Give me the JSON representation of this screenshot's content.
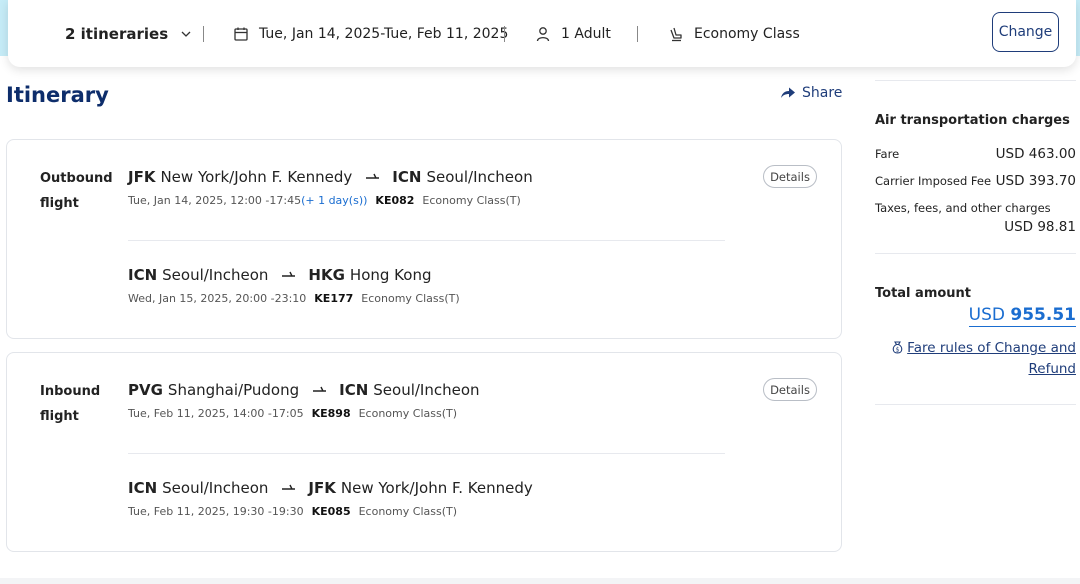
{
  "search": {
    "itineraries": "2 itineraries",
    "dates": "Tue, Jan 14, 2025-Tue, Feb 11, 2025",
    "passengers": "1 Adult",
    "cabin": "Economy Class",
    "change_label": "Change"
  },
  "page": {
    "title": "Itinerary",
    "share_label": "Share"
  },
  "outbound": {
    "label_line1": "Outbound",
    "label_line2": "flight",
    "details_label": "Details",
    "segments": [
      {
        "from_code": "JFK",
        "from_name": "New York/John F. Kennedy",
        "to_code": "ICN",
        "to_name": "Seoul/Incheon",
        "time": "Tue, Jan 14, 2025, 12:00 -17:45",
        "plus_day": "(+ 1 day(s))",
        "flight": "KE082",
        "cabin": "Economy Class(T)"
      },
      {
        "from_code": "ICN",
        "from_name": "Seoul/Incheon",
        "to_code": "HKG",
        "to_name": "Hong Kong",
        "time": "Wed, Jan 15, 2025, 20:00 -23:10",
        "flight": "KE177",
        "cabin": "Economy Class(T)"
      }
    ]
  },
  "inbound": {
    "label_line1": "Inbound",
    "label_line2": "flight",
    "details_label": "Details",
    "segments": [
      {
        "from_code": "PVG",
        "from_name": "Shanghai/Pudong",
        "to_code": "ICN",
        "to_name": "Seoul/Incheon",
        "time": "Tue, Feb 11, 2025, 14:00 -17:05",
        "flight": "KE898",
        "cabin": "Economy Class(T)"
      },
      {
        "from_code": "ICN",
        "from_name": "Seoul/Incheon",
        "to_code": "JFK",
        "to_name": "New York/John F. Kennedy",
        "time": "Tue, Feb 11, 2025, 19:30 -19:30",
        "flight": "KE085",
        "cabin": "Economy Class(T)"
      }
    ]
  },
  "summary": {
    "heading": "Air transportation charges",
    "fare_label": "Fare",
    "fare_value": "USD 463.00",
    "carrier_label": "Carrier Imposed Fee",
    "carrier_value": "USD 393.70",
    "taxes_label": "Taxes, fees, and other charges",
    "taxes_value": "USD 98.81",
    "total_label": "Total amount",
    "total_currency": "USD",
    "total_amount": "955.51",
    "rules_line1": "Fare rules of Change and",
    "rules_line2": "Refund"
  },
  "colors": {
    "accent_navy": "#0d2d6b",
    "link_blue": "#1a6dd0",
    "header_strip": "#c6ecf7"
  }
}
